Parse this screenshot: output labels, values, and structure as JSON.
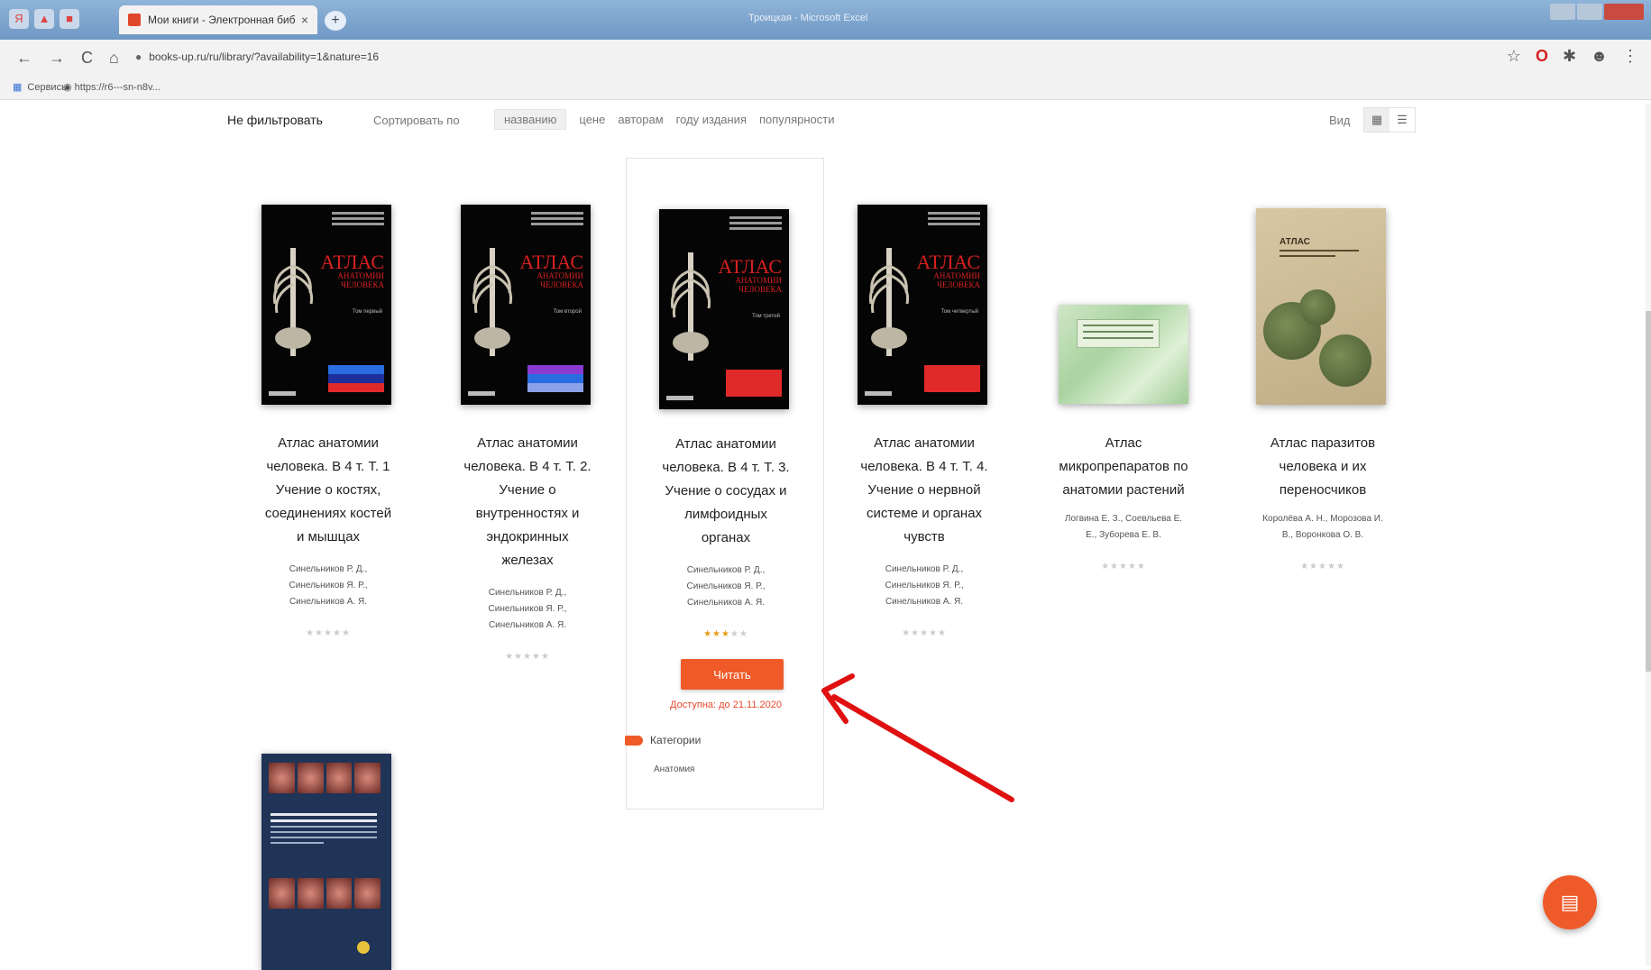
{
  "browser": {
    "tab_title": "Мои книги - Электронная биб",
    "tab_close": "×",
    "new_tab": "+",
    "window_title": "Троицкая - Microsoft Excel",
    "url": "books-up.ru/ru/library/?availability=1&nature=16",
    "bookmarks": {
      "apps": "Сервисы",
      "link": "https://r6---sn-n8v..."
    }
  },
  "filters": {
    "no_filter": "Не фильтровать",
    "sort_label": "Сортировать по",
    "sort_options": [
      "названию",
      "цене",
      "авторам",
      "году издания",
      "популярности"
    ],
    "active_sort": "названию",
    "view_label": "Вид"
  },
  "books": [
    {
      "title_lines": [
        "Атлас анатомии",
        "человека. В 4 т. Т. 1",
        "Учение о костях,",
        "соединениях костей",
        "и мышцах"
      ],
      "author_lines": [
        "Синельников Р. Д.,",
        "Синельников Я. Р.,",
        "Синельников А. Я."
      ],
      "stars": "★★★★★",
      "rating": 0,
      "cover_title": "АТЛАС",
      "cover_sub1": "АНАТОМИИ",
      "cover_sub2": "ЧЕЛОВЕКА",
      "cover_vol": "Том первый"
    },
    {
      "title_lines": [
        "Атлас анатомии",
        "человека. В 4 т. Т. 2.",
        "Учение о",
        "внутренностях и",
        "эндокринных",
        "железах"
      ],
      "author_lines": [
        "Синельников Р. Д.,",
        "Синельников Я. Р.,",
        "Синельников А. Я."
      ],
      "stars": "★★★★★",
      "rating": 0,
      "cover_title": "АТЛАС",
      "cover_sub1": "АНАТОМИИ",
      "cover_sub2": "ЧЕЛОВЕКА",
      "cover_vol": "Том второй"
    },
    {
      "title_lines": [
        "Атлас анатомии",
        "человека. В 4 т. Т. 3.",
        "Учение о сосудах и",
        "лимфоидных",
        "органах"
      ],
      "author_lines": [
        "Синельников Р. Д.,",
        "Синельников Я. Р.,",
        "Синельников А. Я."
      ],
      "stars_filled": "★★★",
      "stars_empty": "★★",
      "rating": 3,
      "read_button": "Читать",
      "availability": "Доступна: до 21.11.2020",
      "categories_label": "Категории",
      "category": "Анатомия",
      "cover_title": "АТЛАС",
      "cover_sub1": "АНАТОМИИ",
      "cover_sub2": "ЧЕЛОВЕКА",
      "cover_vol": "Том третий"
    },
    {
      "title_lines": [
        "Атлас анатомии",
        "человека. В 4 т. Т. 4.",
        "Учение о нервной",
        "системе и органах",
        "чувств"
      ],
      "author_lines": [
        "Синельников Р. Д.,",
        "Синельников Я. Р.,",
        "Синельников А. Я."
      ],
      "stars": "★★★★★",
      "rating": 0,
      "cover_title": "АТЛАС",
      "cover_sub1": "АНАТОМИИ",
      "cover_sub2": "ЧЕЛОВЕКА",
      "cover_vol": "Том четвертый"
    },
    {
      "title_lines": [
        "Атлас",
        "микропрепаратов по",
        "анатомии растений"
      ],
      "author_lines": [
        "Логвина Е. З., Соевльева Е.",
        "Е., Зуборева Е. В."
      ],
      "stars": "★★★★★",
      "rating": 0
    },
    {
      "title_lines": [
        "Атлас паразитов",
        "человека и их",
        "переносчиков"
      ],
      "author_lines": [
        "Королёва А. Н., Морозова И.",
        "В., Воронкова О. В."
      ],
      "stars": "★★★★★",
      "rating": 0,
      "cover_title": "АТЛАС"
    }
  ],
  "colors": {
    "accent": "#f05a28",
    "arrow": "#e01010",
    "star_filled": "#e69b17",
    "star_empty": "#cccccc"
  },
  "icons": [
    "back-icon",
    "forward-icon",
    "reload-icon",
    "home-icon",
    "lock-icon",
    "star-icon",
    "opera-icon",
    "extensions-icon",
    "profile-icon",
    "grid-view-icon",
    "list-view-icon",
    "tag-icon",
    "notes-icon",
    "arrow-annotation"
  ]
}
